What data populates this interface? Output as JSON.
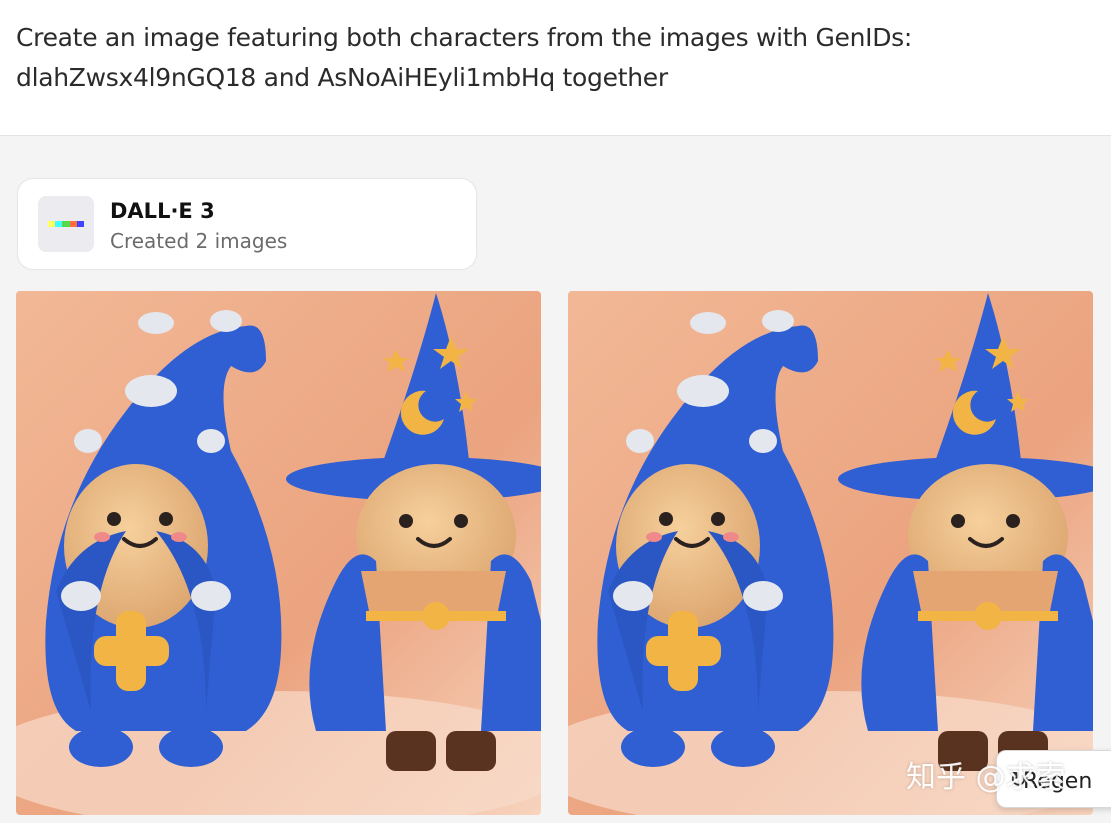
{
  "prompt": {
    "text": "Create an image featuring both characters from the images with GenIDs: dlahZwsx4l9nGQ18 and AsNoAiHEyli1mbHq together"
  },
  "dalle": {
    "logo_icon": "dalle-logo-icon",
    "title": "DALL·E 3",
    "subtitle": "Created 2 images",
    "logo_colors": [
      "#ffff66",
      "#42ffff",
      "#51da4c",
      "#ff6e3c",
      "#3c46ff"
    ]
  },
  "images": [
    {
      "name": "generated-image-1"
    },
    {
      "name": "generated-image-2"
    }
  ],
  "watermark": {
    "text": "知乎 @求索"
  },
  "regenerate": {
    "label": "Regen",
    "icon": "refresh-icon"
  },
  "colors": {
    "hat_blue": "#2d5fd6",
    "skin": "#e9b884",
    "bg_peach": "#eeaa86",
    "star_gold": "#f2b544",
    "cloud_silver": "#dfe3ea"
  }
}
